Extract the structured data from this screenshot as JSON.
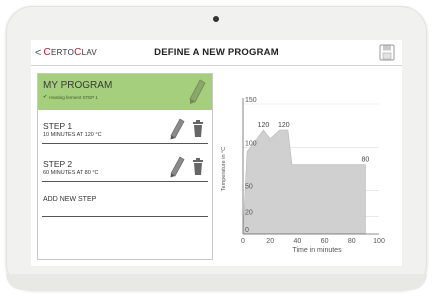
{
  "topbar": {
    "back_label": "<",
    "brand_first_initial": "C",
    "brand_first_rest": "ERTO",
    "brand_second_initial": "C",
    "brand_second_rest": "LAV",
    "title": "DEFINE A NEW PROGRAM",
    "save_icon": "save-icon"
  },
  "program": {
    "name": "MY PROGRAM",
    "subtitle": "Heating ferment STEP 1",
    "edit_icon": "pencil-icon",
    "header_color": "#a5cf7c"
  },
  "steps": [
    {
      "label": "STEP 1",
      "detail": "10 MINUTES AT 120 °C"
    },
    {
      "label": "STEP 2",
      "detail": "60 MINUTES AT 80 °C"
    }
  ],
  "add_step_label": "ADD NEW STEP",
  "colors": {
    "brand_red": "#c8102e",
    "chart_fill": "#d0d0d0"
  },
  "chart_data": {
    "type": "area",
    "x": [
      0,
      3,
      8,
      15,
      20,
      27,
      30,
      33,
      36,
      40,
      90
    ],
    "y": [
      0,
      95,
      105,
      120,
      110,
      120,
      120,
      120,
      80,
      80,
      80
    ],
    "data_labels": [
      {
        "x": 15,
        "y": 120,
        "text": "120"
      },
      {
        "x": 30,
        "y": 120,
        "text": "120"
      },
      {
        "x": 90,
        "y": 80,
        "text": "80"
      }
    ],
    "xlabel": "Time in minutes",
    "ylabel": "Temperature in °C",
    "xlim": [
      0,
      100
    ],
    "ylim": [
      0,
      150
    ],
    "xticks": [
      0,
      20,
      40,
      60,
      80,
      100
    ],
    "yticks": [
      0,
      20,
      50,
      100,
      150
    ],
    "grid": true
  }
}
